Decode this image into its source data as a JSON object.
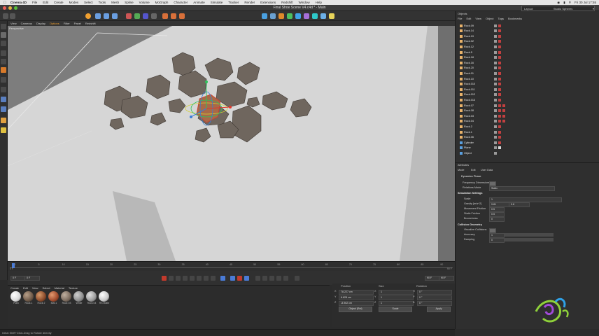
{
  "mac_menu": {
    "app": "Cinema 4D",
    "items": [
      "File",
      "Edit",
      "Create",
      "Modes",
      "Select",
      "Tools",
      "Mesh",
      "Spline",
      "Volume",
      "MoGraph",
      "Character",
      "Animate",
      "Simulate",
      "Tracker",
      "Render",
      "Extensions",
      "Redshift",
      "Window",
      "Help"
    ],
    "clock": "Fri 30 Jul 17:55"
  },
  "window": {
    "title": "Final Shoe Scene V4.c4d * - Main",
    "layout_label": "Layout:",
    "layout_value": "Studio Spheres"
  },
  "viewport": {
    "menu": [
      "View",
      "Cameras",
      "Display",
      "Options",
      "Filter",
      "Panel",
      "Redshift"
    ],
    "label": "Perspective"
  },
  "timeline": {
    "ticks": [
      "0",
      "5",
      "10",
      "15",
      "20",
      "25",
      "30",
      "35",
      "40",
      "45",
      "50",
      "55",
      "60",
      "65",
      "70",
      "75",
      "80",
      "85",
      "90"
    ],
    "start_frame": "0 F",
    "end_frame": "90 F",
    "current_frame": "0 F"
  },
  "materials": {
    "menu": [
      "Create",
      "Edit",
      "View",
      "Select",
      "Material",
      "Texture"
    ],
    "items": [
      {
        "name": "Plain",
        "color": "#d9d9d9"
      },
      {
        "name": "Rock.1",
        "color": "#6f5a49"
      },
      {
        "name": "Rock 2",
        "color": "#8a4a2b"
      },
      {
        "name": "Mat.1",
        "color": "#a04a2c"
      },
      {
        "name": "Rock 03",
        "color": "#7b6b5e"
      },
      {
        "name": "White",
        "color": "#8c8c8c"
      },
      {
        "name": "Rock.04",
        "color": "#9a9a9a"
      },
      {
        "name": "RS Matte",
        "color": "#c8c8c8"
      }
    ]
  },
  "coordinates": {
    "headers": [
      "Position",
      "Size",
      "Rotation"
    ],
    "rows": [
      {
        "axis": "X",
        "position": "78.227 cm",
        "size_axis": "X",
        "size": "1",
        "rot_axis": "H",
        "rotation": "0 °"
      },
      {
        "axis": "Y",
        "position": "6.628 cm",
        "size_axis": "Y",
        "size": "1",
        "rot_axis": "P",
        "rotation": "0 °"
      },
      {
        "axis": "Z",
        "position": "-8.962 cm",
        "size_axis": "Z",
        "size": "1",
        "rot_axis": "B",
        "rotation": "0 °"
      }
    ],
    "mode_object": "Object (Rel)",
    "mode_size": "Scale",
    "apply_label": "Apply"
  },
  "status": "Initial Shift+Click-Drag to Rotate directly",
  "object_manager": {
    "title": "Objects",
    "menu": [
      "File",
      "Edit",
      "View",
      "Object",
      "Tags",
      "Bookmarks"
    ],
    "objects": [
      {
        "name": "Rock.09",
        "color": "#e8b26a",
        "tags": [
          "#9a9a9a",
          "#c24040"
        ]
      },
      {
        "name": "Rock.14",
        "color": "#e8b26a",
        "tags": [
          "#9a9a9a",
          "#c24040"
        ]
      },
      {
        "name": "Rock.19",
        "color": "#e8b26a",
        "tags": [
          "#9a9a9a",
          "#c24040"
        ]
      },
      {
        "name": "Rock.02",
        "color": "#e8b26a",
        "tags": [
          "#9a9a9a",
          "#c24040"
        ]
      },
      {
        "name": "Rock.12",
        "color": "#e8b26a",
        "tags": [
          "#9a9a9a",
          "#c24040"
        ]
      },
      {
        "name": "Rock.5",
        "color": "#e8b26a",
        "tags": [
          "#9a9a9a",
          "#c24040"
        ]
      },
      {
        "name": "Rock.18",
        "color": "#e8b26a",
        "tags": [
          "#9a9a9a",
          "#c24040"
        ]
      },
      {
        "name": "Rock.16",
        "color": "#e8b26a",
        "tags": [
          "#9a9a9a",
          "#c24040"
        ]
      },
      {
        "name": "Rock.20",
        "color": "#e8b26a",
        "tags": [
          "#9a9a9a",
          "#c24040"
        ]
      },
      {
        "name": "Rock.01",
        "color": "#e8b26a",
        "tags": [
          "#9a9a9a",
          "#c24040"
        ]
      },
      {
        "name": "Rock.10",
        "color": "#e8b26a",
        "tags": [
          "#9a9a9a",
          "#c24040"
        ]
      },
      {
        "name": "Rock.010",
        "color": "#e8b26a",
        "tags": [
          "#9a9a9a",
          "#c24040"
        ]
      },
      {
        "name": "Rock.011",
        "color": "#e8b26a",
        "tags": [
          "#9a9a9a",
          "#c24040"
        ]
      },
      {
        "name": "Rock.012",
        "color": "#e8b26a",
        "tags": [
          "#9a9a9a",
          "#c24040"
        ]
      },
      {
        "name": "Rock.013",
        "color": "#e8b26a",
        "tags": [
          "#9a9a9a",
          "#c24040"
        ]
      },
      {
        "name": "Rock.07",
        "color": "#e8b26a",
        "tags": [
          "#9a9a9a",
          "#c24040",
          "#c24040"
        ]
      },
      {
        "name": "Rock.08",
        "color": "#e8b26a",
        "tags": [
          "#9a9a9a",
          "#c24040",
          "#c24040"
        ]
      },
      {
        "name": "Rock.03",
        "color": "#e8b26a",
        "tags": [
          "#9a9a9a",
          "#c24040",
          "#c24040"
        ]
      },
      {
        "name": "Rock.04",
        "color": "#e8b26a",
        "tags": [
          "#9a9a9a",
          "#c24040",
          "#c24040"
        ]
      },
      {
        "name": "Rock.2",
        "color": "#e8b26a",
        "tags": [
          "#9a9a9a",
          "#c24040"
        ]
      },
      {
        "name": "Rock.1",
        "color": "#e8b26a",
        "tags": [
          "#9a9a9a",
          "#c24040"
        ]
      },
      {
        "name": "Rock.06",
        "color": "#e8b26a",
        "tags": [
          "#9a9a9a",
          "#c24040"
        ]
      },
      {
        "name": "Cylinder",
        "color": "#5aa0e0",
        "tags": [
          "#9a9a9a",
          "#c24040"
        ]
      },
      {
        "name": "Plane",
        "color": "#5aa0e0",
        "tags": [
          "#9a9a9a",
          "#d9d9d9"
        ]
      },
      {
        "name": "Object",
        "color": "#5aa0e0",
        "tags": [
          "#9a9a9a"
        ]
      }
    ]
  },
  "attributes": {
    "title": "Attributes",
    "menu": [
      "Mode",
      "Edit",
      "User Data"
    ],
    "object_label": "Dynamics Phase",
    "rows": [
      {
        "label": "Frequency Dimensions",
        "value": ""
      },
      {
        "label": "Relations Mode",
        "value": "Static"
      }
    ],
    "section1": "Simulation Settings",
    "fields": [
      {
        "label": "Scale",
        "value": "1"
      },
      {
        "label": "Gravity [m/s^2]",
        "value": "9.81",
        "value2": "0.8"
      },
      {
        "label": "Movement Friction",
        "value": "0.5"
      },
      {
        "label": "Static Friction",
        "value": "0.5"
      },
      {
        "label": "Bounciness",
        "value": "0"
      }
    ],
    "section2": "Collision Geometry",
    "fields2": [
      {
        "label": "Visualize Collisions",
        "value": ""
      },
      {
        "label": "Accuracy",
        "value": "1"
      },
      {
        "label": "Damping",
        "value": "0"
      }
    ]
  },
  "colors": {
    "accent": "#4a7bd6",
    "selected_orange": "#f0a030"
  }
}
